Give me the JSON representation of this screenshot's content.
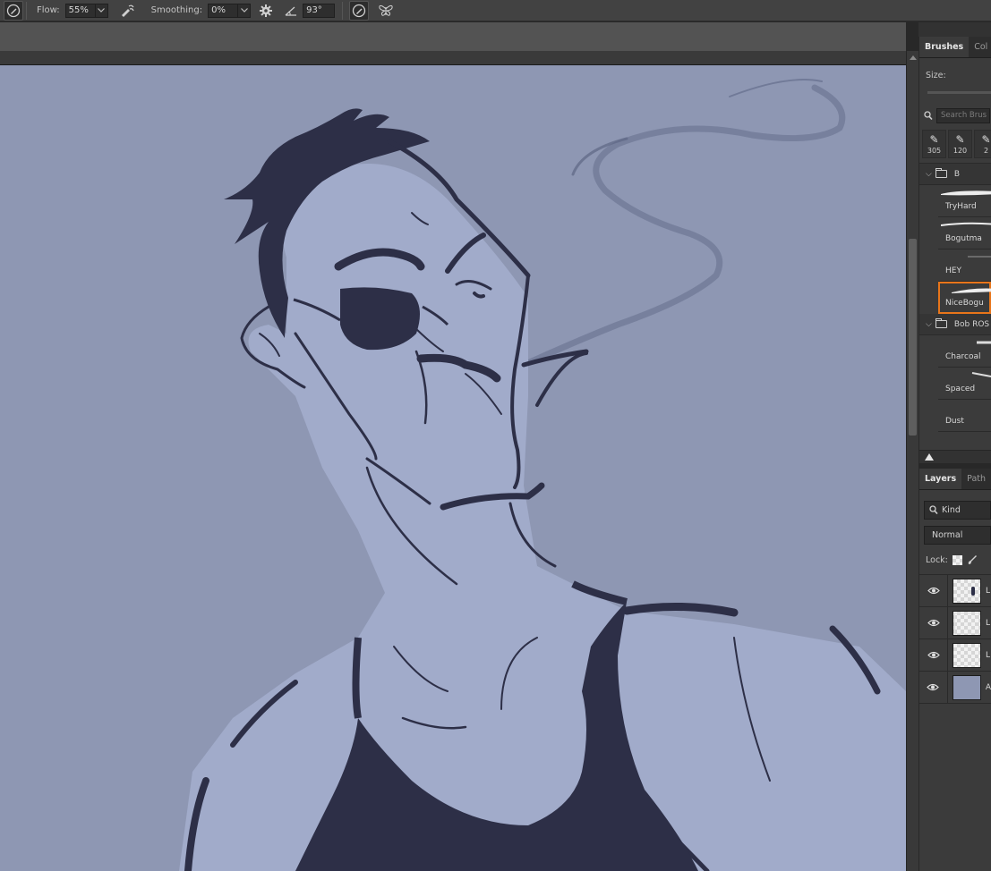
{
  "options_bar": {
    "flow_label": "Flow:",
    "flow_value": "55%",
    "smoothing_label": "Smoothing:",
    "smoothing_value": "0%",
    "angle_value": "93°"
  },
  "brushes_panel": {
    "tabs": [
      "Brushes",
      "Col"
    ],
    "size_label": "Size:",
    "search_placeholder": "Search Brus",
    "recent_sizes": [
      "305",
      "120",
      "2"
    ],
    "groups": [
      {
        "name": "B",
        "brushes": [
          "TryHard",
          "Bogutma",
          "HEY",
          "NiceBogu"
        ],
        "selected": "NiceBogu"
      },
      {
        "name": "Bob ROS",
        "brushes": [
          "Charcoal",
          "Spaced",
          "Dust"
        ]
      }
    ]
  },
  "layers_panel": {
    "tabs": [
      "Layers",
      "Path"
    ],
    "filter_value": "Kind",
    "blend_mode": "Normal",
    "lock_label": "Lock:",
    "layers": [
      {
        "name": "L",
        "thumb": "ink"
      },
      {
        "name": "L",
        "thumb": "checker"
      },
      {
        "name": "L",
        "thumb": "checker"
      },
      {
        "name": "A",
        "thumb": "fill"
      }
    ]
  },
  "colors": {
    "canvas_background": "#8e97b3",
    "skin": "#a1abca",
    "ink": "#2d2f47",
    "selection_outline": "#e8751a"
  }
}
